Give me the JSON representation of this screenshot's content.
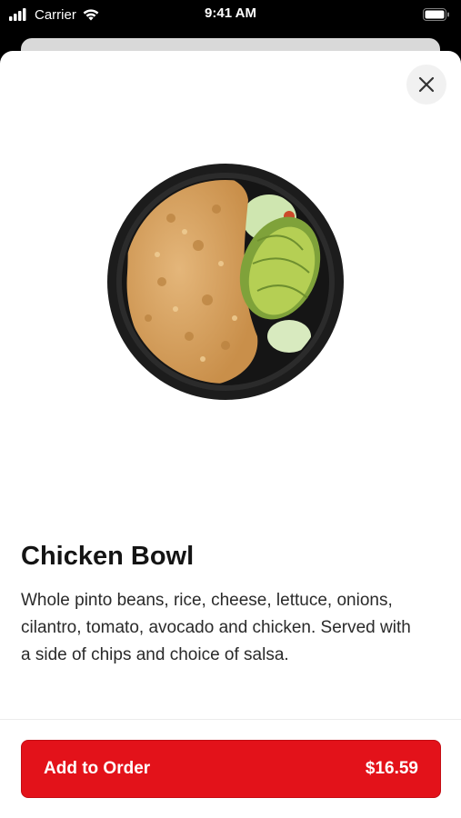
{
  "status_bar": {
    "carrier": "Carrier",
    "time": "9:41 AM"
  },
  "icons": {
    "signal": "signal-bars-icon",
    "wifi": "wifi-icon",
    "battery": "battery-icon",
    "close": "close-icon"
  },
  "item": {
    "title": "Chicken Bowl",
    "description": "Whole pinto beans, rice, cheese, lettuce, onions, cilantro, tomato, avocado and chicken. Served with a side of chips and choice of salsa."
  },
  "order_button": {
    "label": "Add to Order",
    "price": "$16.59"
  },
  "colors": {
    "accent": "#e3121a",
    "background": "#ffffff",
    "status_bar": "#000000"
  }
}
